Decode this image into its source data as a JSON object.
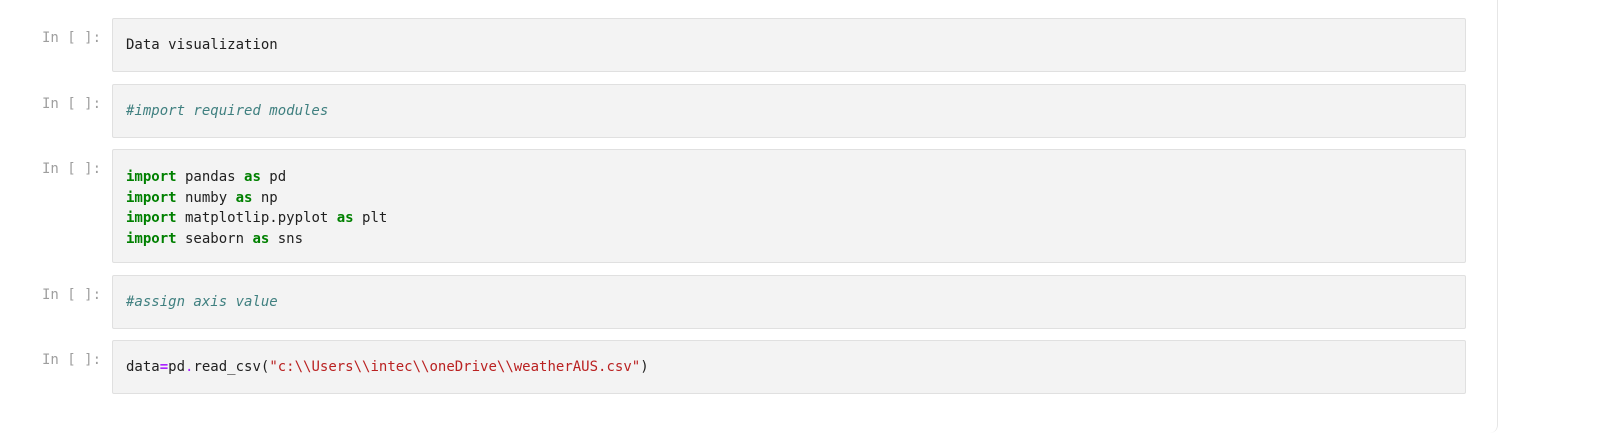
{
  "cells": [
    {
      "prompt": "In [ ]:",
      "text": "Data visualization"
    },
    {
      "prompt": "In [ ]:",
      "comment": "#import required modules"
    },
    {
      "prompt": "In [ ]:",
      "lines": [
        {
          "kw1": "import",
          "mod": " pandas ",
          "kw2": "as",
          "alias": " pd"
        },
        {
          "kw1": "import",
          "mod": " numby ",
          "kw2": "as",
          "alias": " np"
        },
        {
          "kw1": "import",
          "mod": " matplotlip.pyplot ",
          "kw2": "as",
          "alias": " plt"
        },
        {
          "kw1": "import",
          "mod": " seaborn ",
          "kw2": "as",
          "alias": " sns"
        }
      ]
    },
    {
      "prompt": "In [ ]:",
      "comment": "#assign axis value"
    },
    {
      "prompt": "In [ ]:",
      "var": "data",
      "eq": "=",
      "obj": "pd",
      "dot": ".",
      "func": "read_csv(",
      "arg": "\"c:\\\\Users\\\\intec\\\\oneDrive\\\\weatherAUS.csv\"",
      "close": ")"
    }
  ]
}
